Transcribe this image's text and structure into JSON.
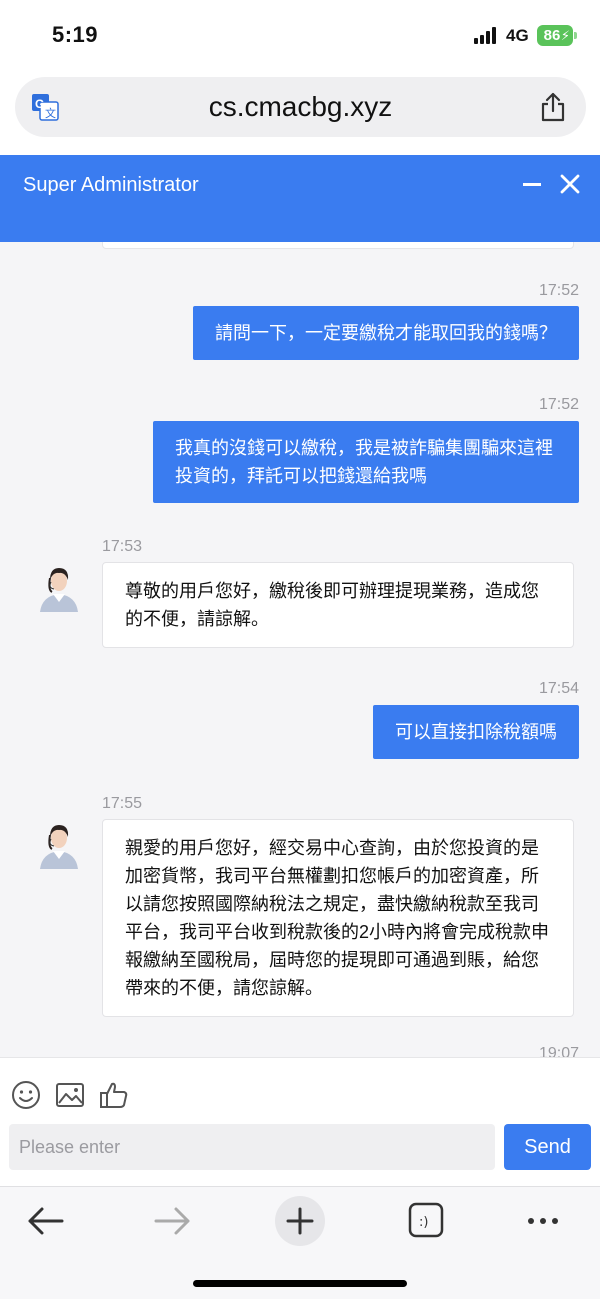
{
  "status_bar": {
    "time": "5:19",
    "network": "4G",
    "battery": "86"
  },
  "browser": {
    "url": "cs.cmacbg.xyz"
  },
  "chat": {
    "title": "Super Administrator",
    "messages": [
      {
        "direction": "out",
        "time": "17:52",
        "text": "請問一下，一定要繳稅才能取回我的錢嗎？"
      },
      {
        "direction": "out",
        "time": "17:52",
        "text": "我真的沒錢可以繳稅，我是被詐騙集團騙來這裡投資的，拜託可以把錢還給我嗎"
      },
      {
        "direction": "in",
        "time": "17:53",
        "text": "尊敬的用戶您好，繳稅後即可辦理提現業務，造成您的不便，請諒解。"
      },
      {
        "direction": "out",
        "time": "17:54",
        "text": "可以直接扣除稅額嗎"
      },
      {
        "direction": "in",
        "time": "17:55",
        "text": "親愛的用戶您好，經交易中心查詢，由於您投資的是加密貨幣，我司平台無權劃扣您帳戶的加密資產，所以請您按照國際納稅法之規定，盡快繳納稅款至我司平台，我司平台收到稅款後的2小時內將會完成稅款申報繳納至國稅局，屆時您的提現即可通過到賬，給您帶來的不便，請您諒解。"
      },
      {
        "direction": "out",
        "time": "19:07",
        "text": ""
      }
    ]
  },
  "input": {
    "placeholder": "Please enter",
    "send_label": "Send"
  },
  "colors": {
    "accent": "#3a7cf0",
    "battery": "#5ac35a"
  }
}
